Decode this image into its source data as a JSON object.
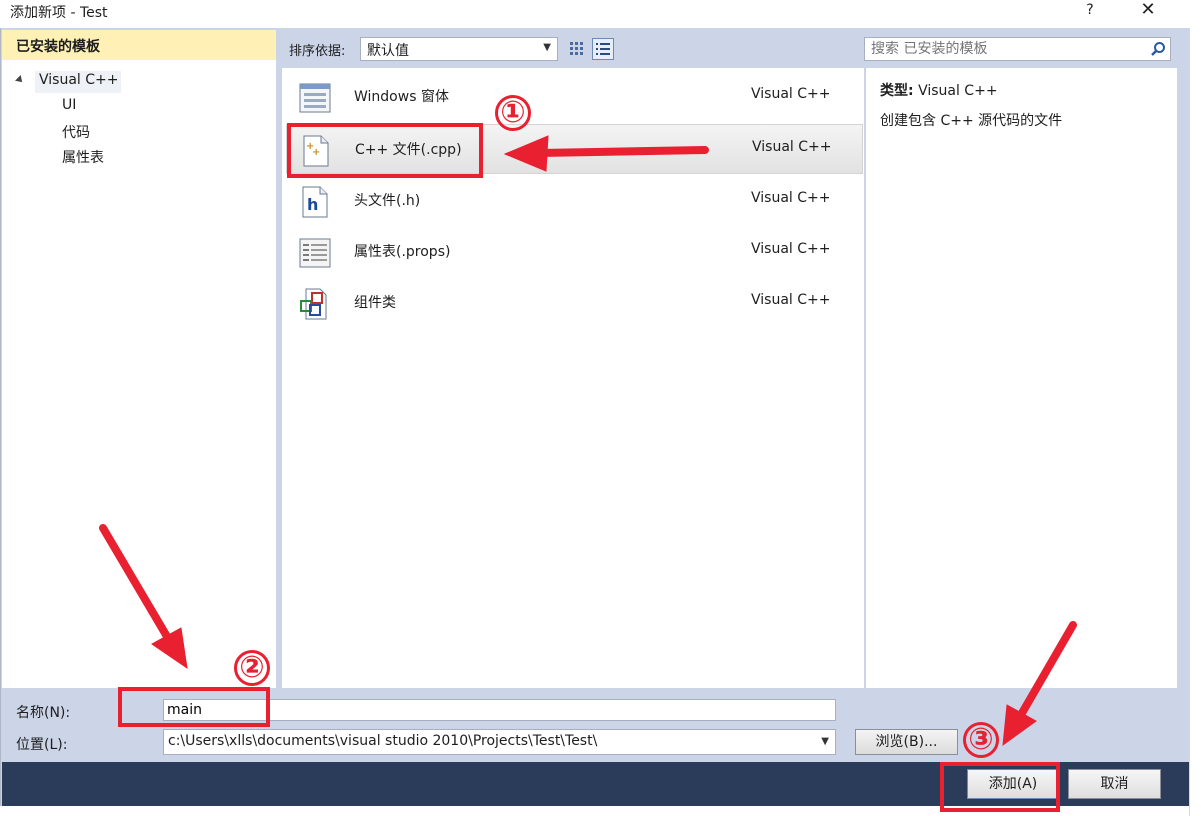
{
  "window": {
    "title": "添加新项 - Test",
    "help": "?",
    "close": "✕"
  },
  "left": {
    "header": "已安装的模板",
    "root": "Visual C++",
    "children": [
      "UI",
      "代码",
      "属性表"
    ]
  },
  "sort": {
    "label": "排序依据:",
    "value": "默认值"
  },
  "search": {
    "placeholder": "搜索 已安装的模板"
  },
  "items": [
    {
      "name": "Windows 窗体",
      "category": "Visual C++",
      "icon": "windows-form-icon"
    },
    {
      "name": "C++ 文件(.cpp)",
      "category": "Visual C++",
      "icon": "cpp-file-icon"
    },
    {
      "name": "头文件(.h)",
      "category": "Visual C++",
      "icon": "header-file-icon"
    },
    {
      "name": "属性表(.props)",
      "category": "Visual C++",
      "icon": "property-sheet-icon"
    },
    {
      "name": "组件类",
      "category": "Visual C++",
      "icon": "component-class-icon"
    }
  ],
  "details": {
    "type_label": "类型:",
    "type_value": "Visual C++",
    "description": "创建包含 C++ 源代码的文件"
  },
  "form": {
    "name_label": "名称(N):",
    "name_value": "main",
    "location_label": "位置(L):",
    "location_value": "c:\\Users\\xlls\\documents\\visual studio 2010\\Projects\\Test\\Test\\",
    "browse_label": "浏览(B)..."
  },
  "buttons": {
    "add": "添加(A)",
    "cancel": "取消"
  },
  "annotations": [
    "①",
    "②",
    "③"
  ],
  "colors": {
    "annotation": "#e82030",
    "footer": "#2b3b5a",
    "header_highlight": "#fff1b6"
  }
}
